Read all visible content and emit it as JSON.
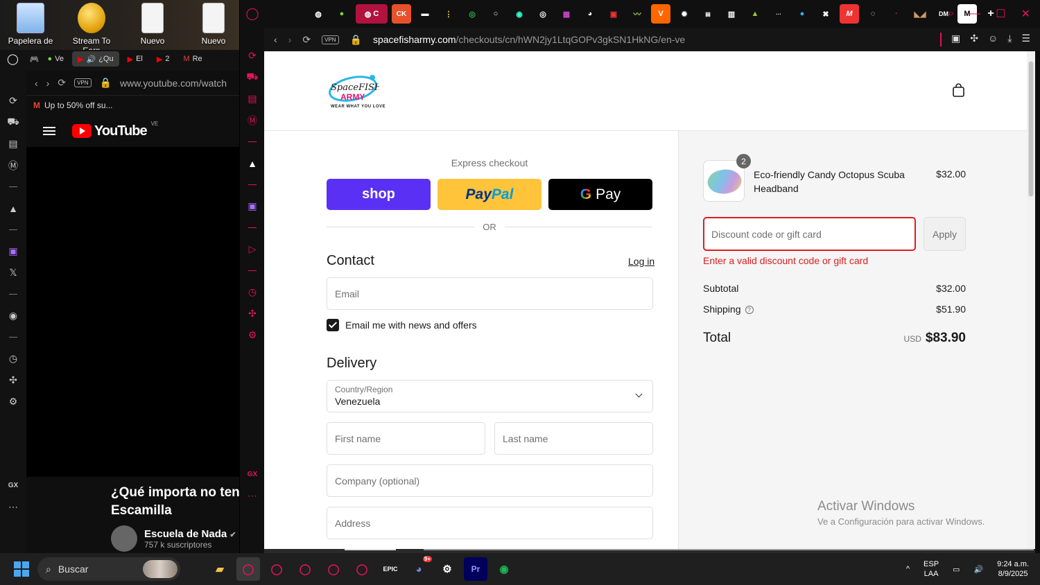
{
  "desktop": {
    "icons": [
      {
        "label": "Papelera de",
        "icon": "recycle-bin-icon"
      },
      {
        "label": "Stream To Earn",
        "icon": "coin-icon"
      },
      {
        "label": "Nuevo",
        "icon": "document-icon"
      },
      {
        "label": "Nuevo",
        "icon": "document-icon"
      }
    ]
  },
  "left_browser": {
    "tabs": [
      "Ve",
      "¿Qu",
      "El",
      "2",
      "Re"
    ],
    "address": "www.youtube.com/watch",
    "vpn": "VPN",
    "bookmark": "Up to 50% off su...",
    "yt_logo": "YouTube",
    "yt_region": "VE",
    "video_title_1": "¿Qué importa no tene",
    "video_title_2": "Escamilla",
    "channel_name": "Escuela de Nada",
    "channel_subs": "757 k suscriptores",
    "side_bottom": "GX"
  },
  "browser": {
    "vpn": "VPN",
    "url_host": "spacefisharmy.com",
    "url_path": "/checkouts/cn/hWN2jy1LtqGOPv3gkSN1HkNG/en-ve",
    "active_tab_label": "C",
    "side_bottom": "GX"
  },
  "checkout": {
    "logo_top": "SpaceFISH",
    "logo_army": "ARMY",
    "logo_tagline": "WEAR WHAT YOU LOVE",
    "express_label": "Express checkout",
    "shop_label": "shop",
    "paypal_label_1": "Pay",
    "paypal_label_2": "Pal",
    "gpay_label": "Pay",
    "gpay_g": "G",
    "or_label": "OR",
    "contact_title": "Contact",
    "login_label": "Log in",
    "email_placeholder": "Email",
    "email_opt_in": "Email me with news and offers",
    "delivery_title": "Delivery",
    "country_label": "Country/Region",
    "country_value": "Venezuela",
    "first_name_placeholder": "First name",
    "last_name_placeholder": "Last name",
    "company_placeholder": "Company (optional)",
    "address_placeholder": "Address"
  },
  "summary": {
    "item_name": "Eco-friendly Candy Octopus Scuba Headband",
    "item_qty": "2",
    "item_price": "$32.00",
    "discount_placeholder": "Discount code or gift card",
    "apply_label": "Apply",
    "discount_error": "Enter a valid discount code or gift card",
    "subtotal_label": "Subtotal",
    "subtotal_value": "$32.00",
    "shipping_label": "Shipping",
    "shipping_value": "$51.90",
    "total_label": "Total",
    "currency": "USD",
    "total_value": "$83.90"
  },
  "watermark": {
    "title": "Activar Windows",
    "subtitle": "Ve a Configuración para activar Windows."
  },
  "taskbar": {
    "search_placeholder": "Buscar",
    "lang_1": "ESP",
    "lang_2": "LAA",
    "time": "9:24 a.m.",
    "date": "8/9/2025",
    "discord_badge": "9+"
  },
  "colors": {
    "opera_red": "#e5125a",
    "shop_purple": "#5a31f4",
    "paypal_yellow": "#ffc439",
    "error_red": "#dd1d1d"
  }
}
